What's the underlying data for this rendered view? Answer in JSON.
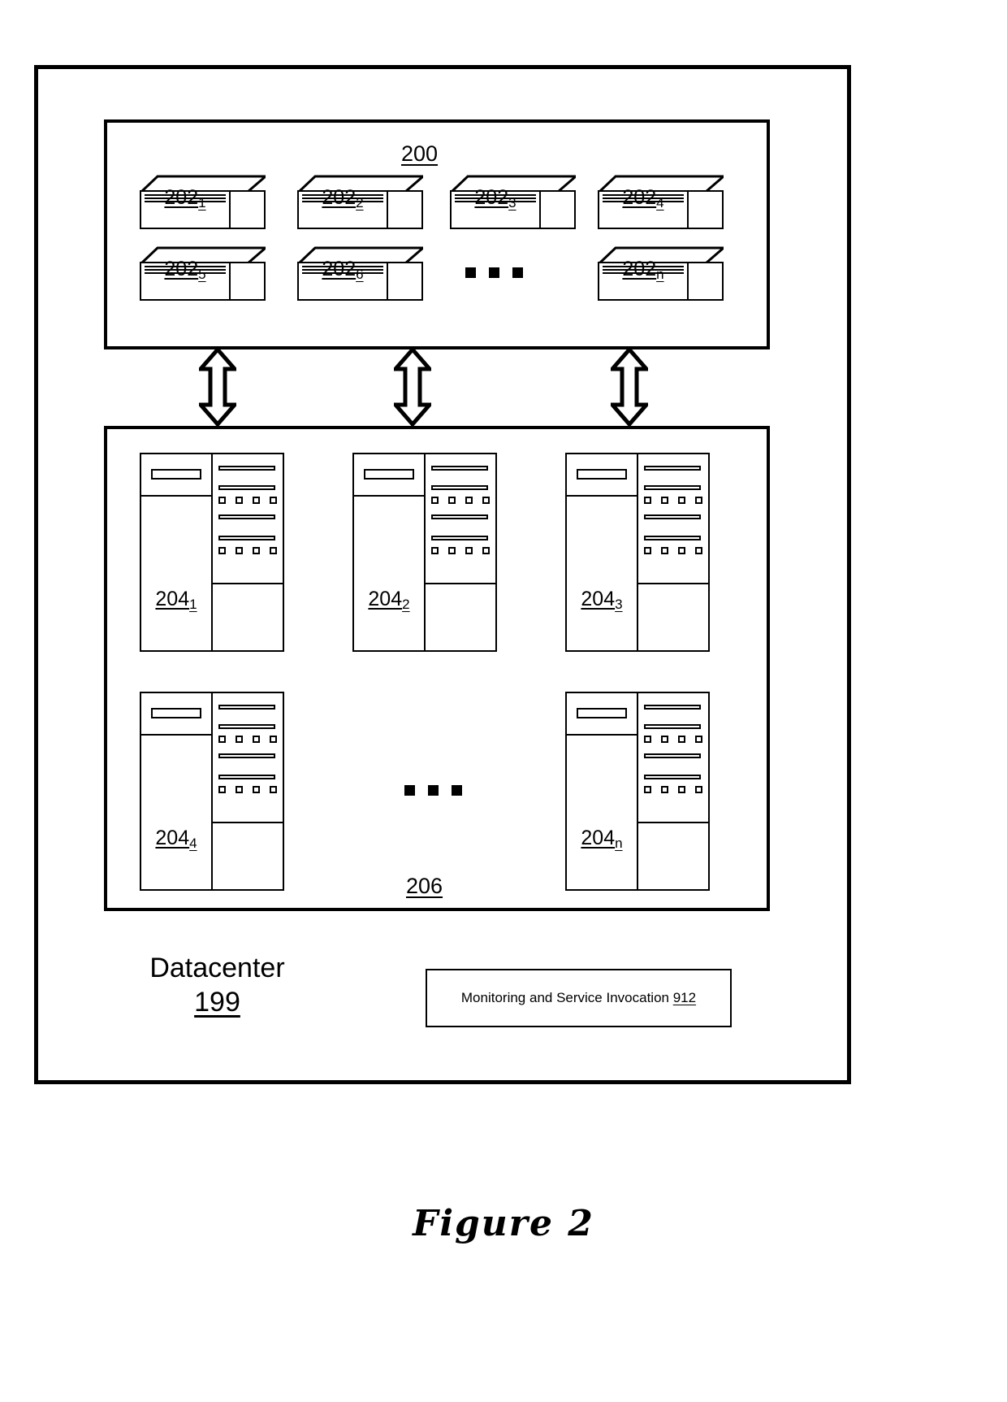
{
  "figure": {
    "caption": "Figure 2"
  },
  "outer": {
    "datacenter_name": "Datacenter",
    "datacenter_ref": "199"
  },
  "switch_group": {
    "ref": "200",
    "ellipsis": "■ ■ ■",
    "items": [
      {
        "base": "202",
        "sub": "1"
      },
      {
        "base": "202",
        "sub": "2"
      },
      {
        "base": "202",
        "sub": "3"
      },
      {
        "base": "202",
        "sub": "4"
      },
      {
        "base": "202",
        "sub": "5"
      },
      {
        "base": "202",
        "sub": "6"
      },
      {
        "base": "202",
        "sub": "n"
      }
    ]
  },
  "rack_group": {
    "ref": "206",
    "items": [
      {
        "base": "204",
        "sub": "1"
      },
      {
        "base": "204",
        "sub": "2"
      },
      {
        "base": "204",
        "sub": "3"
      },
      {
        "base": "204",
        "sub": "4"
      },
      {
        "base": "204",
        "sub": "n"
      }
    ]
  },
  "connectors": {
    "count": 3,
    "type": "double-headed-vertical-arrow"
  },
  "monitoring": {
    "label": "Monitoring and Service Invocation",
    "ref": "912"
  },
  "colors": {
    "stroke": "#000000",
    "background": "#ffffff"
  }
}
